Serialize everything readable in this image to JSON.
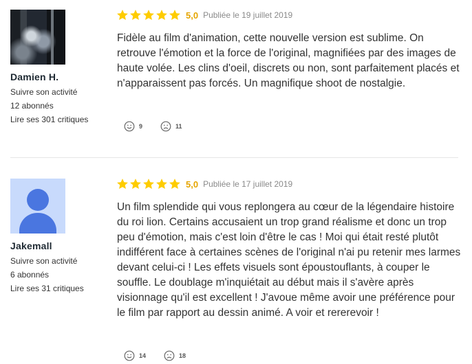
{
  "reviews": [
    {
      "avatar": "user-photo",
      "user": {
        "name": "Damien H.",
        "follow": "Suivre son activité",
        "followers": "12 abonnés",
        "reviews": "Lire ses 301 critiques"
      },
      "rating": {
        "stars": 5,
        "score": "5,0",
        "date": "Publiée le 19 juillet 2019"
      },
      "text": "Fidèle au film d'animation, cette nouvelle version est sublime. On retrouve l'émotion et la force de l'original, magnifiées par des images de haute volée. Les clins d'oeil, discrets ou non, sont parfaitement placés et n'apparaissent pas forcés. Un magnifique shoot de nostalgie.",
      "reactions": {
        "like": "9",
        "dislike": "11"
      }
    },
    {
      "avatar": "default-user",
      "user": {
        "name": "Jakemall",
        "follow": "Suivre son activité",
        "followers": "6 abonnés",
        "reviews": "Lire ses 31 critiques"
      },
      "rating": {
        "stars": 5,
        "score": "5,0",
        "date": "Publiée le 17 juillet 2019"
      },
      "text": "Un film splendide qui vous replongera au cœur de la légendaire histoire du roi lion. Certains accusaient un trop grand réalisme et donc un trop peu d'émotion, mais c'est loin d'être le cas ! Moi qui était resté plutôt indifférent face à certaines scènes de l'original n'ai pu retenir mes larmes devant celui-ci ! Les effets visuels sont époustouflants, à couper le souffle. Le doublage m'inquiétait au début mais il s'avère après visionnage qu'il est excellent ! J'avoue même avoir une préférence pour le film par rapport au dessin animé. A voir et rererevoir !",
      "reactions": {
        "like": "14",
        "dislike": "18"
      }
    }
  ],
  "icons": {
    "star": "star-icon",
    "like": "smiley-icon",
    "dislike": "sad-face-icon"
  },
  "colors": {
    "star": "#fecc00",
    "score": "#e5a500",
    "avatar_bg": "#c8dafc",
    "avatar_fg": "#4a76e0"
  }
}
